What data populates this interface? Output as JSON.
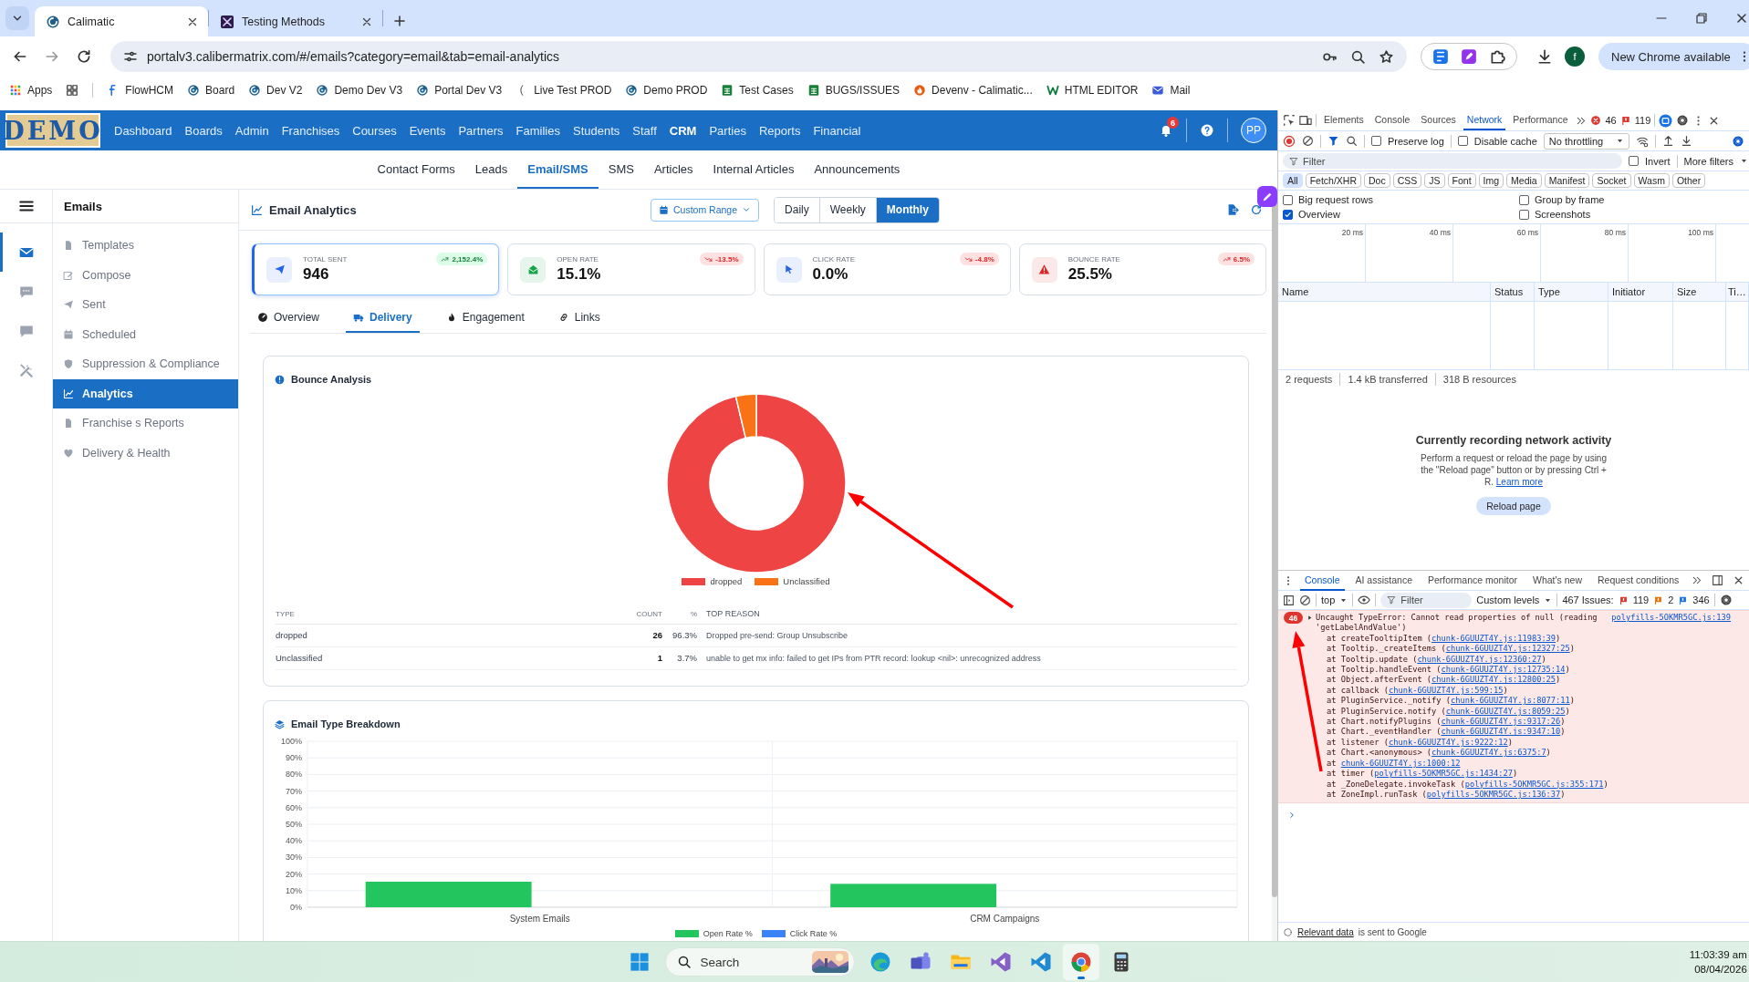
{
  "browser": {
    "tabs": [
      {
        "title": "Calimatic",
        "selected": true
      },
      {
        "title": "Testing Methods",
        "selected": false
      }
    ],
    "url": "portalv3.calibermatrix.com/#/emails?category=email&tab=email-analytics",
    "profile_initial": "f",
    "update_button": "New Chrome available",
    "bookmarks": [
      "Apps",
      "FlowHCM",
      "Board",
      "Dev V2",
      "Demo Dev V3",
      "Portal Dev V3",
      "Live Test PROD",
      "Demo PROD",
      "Test Cases",
      "BUGS/ISSUES",
      "Devenv - Calimatic...",
      "HTML EDITOR",
      "Mail"
    ]
  },
  "app": {
    "logo_text": "DEMO",
    "nav": [
      {
        "label": "Dashboard",
        "selected": false
      },
      {
        "label": "Boards",
        "selected": false
      },
      {
        "label": "Admin",
        "selected": false
      },
      {
        "label": "Franchises",
        "selected": false
      },
      {
        "label": "Courses",
        "selected": false
      },
      {
        "label": "Events",
        "selected": false
      },
      {
        "label": "Partners",
        "selected": false
      },
      {
        "label": "Families",
        "selected": false
      },
      {
        "label": "Students",
        "selected": false
      },
      {
        "label": "Staff",
        "selected": false
      },
      {
        "label": "CRM",
        "selected": true
      },
      {
        "label": "Parties",
        "selected": false
      },
      {
        "label": "Reports",
        "selected": false
      },
      {
        "label": "Financial",
        "selected": false
      }
    ],
    "notification_count": "6",
    "avatar": "PP",
    "subnav": [
      {
        "label": "Contact Forms",
        "selected": false
      },
      {
        "label": "Leads",
        "selected": false
      },
      {
        "label": "Email/SMS",
        "selected": true
      },
      {
        "label": "SMS",
        "selected": false
      },
      {
        "label": "Articles",
        "selected": false
      },
      {
        "label": "Internal Articles",
        "selected": false
      },
      {
        "label": "Announcements",
        "selected": false
      }
    ],
    "rail": [
      {
        "selected": true
      },
      {
        "selected": false
      },
      {
        "selected": false
      },
      {
        "selected": false
      }
    ],
    "sidebar": {
      "title": "Emails",
      "items": [
        {
          "label": "Templates",
          "selected": false
        },
        {
          "label": "Compose",
          "selected": false
        },
        {
          "label": "Sent",
          "selected": false
        },
        {
          "label": "Scheduled",
          "selected": false
        },
        {
          "label": "Suppression & Compliance",
          "selected": false
        },
        {
          "label": "Analytics",
          "selected": true
        },
        {
          "label": "Franchise s Reports",
          "selected": false
        },
        {
          "label": "Delivery & Health",
          "selected": false
        }
      ]
    },
    "header": {
      "title": "Email Analytics",
      "range_button": "Custom Range",
      "periods": [
        {
          "label": "Daily",
          "selected": false
        },
        {
          "label": "Weekly",
          "selected": false
        },
        {
          "label": "Monthly",
          "selected": true
        }
      ]
    },
    "kpis": [
      {
        "label": "TOTAL SENT",
        "value": "946",
        "change": "2,152.4%",
        "trend_up": true,
        "favorable": true,
        "color": "#2563eb",
        "selected": true
      },
      {
        "label": "OPEN RATE",
        "value": "15.1%",
        "change": "-13.5%",
        "trend_up": false,
        "favorable": false,
        "color": "#16a34a",
        "selected": false
      },
      {
        "label": "CLICK RATE",
        "value": "0.0%",
        "change": "-4.8%",
        "trend_up": false,
        "favorable": false,
        "color": "#2563eb",
        "selected": false
      },
      {
        "label": "BOUNCE RATE",
        "value": "25.5%",
        "change": "6.5%",
        "trend_up": true,
        "favorable": false,
        "color": "#dc2626",
        "selected": false
      }
    ],
    "tabs": [
      {
        "label": "Overview",
        "selected": false
      },
      {
        "label": "Delivery",
        "selected": true
      },
      {
        "label": "Engagement",
        "selected": false
      },
      {
        "label": "Links",
        "selected": false
      }
    ],
    "bounce": {
      "title": "Bounce Analysis",
      "chart_data": {
        "type": "donut",
        "legend": "bottom",
        "categories": [
          "dropped",
          "Unclassified"
        ],
        "values": [
          96.3,
          3.7
        ]
      },
      "columns": [
        "TYPE",
        "COUNT",
        "%",
        "TOP REASON"
      ],
      "rows": [
        {
          "type": "dropped",
          "count": "26",
          "percent": "96.3%",
          "reason": "Dropped pre-send: Group Unsubscribe"
        },
        {
          "type": "Unclassified",
          "count": "1",
          "percent": "3.7%",
          "reason": "unable to get mx info: failed to get IPs from PTR record: lookup <nil>: unrecognized address"
        }
      ]
    },
    "breakdown": {
      "title": "Email Type Breakdown",
      "chart_data": {
        "type": "bar",
        "categories": [
          "System Emails",
          "CRM Campaigns"
        ],
        "series": [
          {
            "name": "Open Rate %",
            "color": "#22c55e",
            "values": [
              15.4,
              14.1
            ]
          },
          {
            "name": "Click Rate %",
            "color": "#3b82f6",
            "values": [
              0,
              0
            ]
          }
        ],
        "grid": true,
        "legend": "bottom",
        "ylim": [
          0,
          100
        ],
        "yticks": [
          {
            "value": 0,
            "label": "0%"
          },
          {
            "value": 10,
            "label": "10%"
          },
          {
            "value": 20,
            "label": "20%"
          },
          {
            "value": 30,
            "label": "30%"
          },
          {
            "value": 40,
            "label": "40%"
          },
          {
            "value": 50,
            "label": "50%"
          },
          {
            "value": 60,
            "label": "60%"
          },
          {
            "value": 70,
            "label": "70%"
          },
          {
            "value": 80,
            "label": "80%"
          },
          {
            "value": 90,
            "label": "90%"
          },
          {
            "value": 100,
            "label": "100%"
          }
        ]
      }
    }
  },
  "devtools": {
    "tabs": [
      {
        "label": "Elements",
        "selected": false
      },
      {
        "label": "Console",
        "selected": false
      },
      {
        "label": "Sources",
        "selected": false
      },
      {
        "label": "Network",
        "selected": true
      },
      {
        "label": "Performance",
        "selected": false
      }
    ],
    "error_count": "46",
    "warning_count": "119",
    "preserve_log": {
      "label": "Preserve log",
      "checked": false
    },
    "disable_cache": {
      "label": "Disable cache",
      "checked": false
    },
    "throttling": "No throttling",
    "filter_placeholder": "Filter",
    "invert": {
      "label": "Invert",
      "checked": false
    },
    "more_filters": "More filters",
    "type_filters": [
      {
        "label": "All",
        "selected": true
      },
      {
        "label": "Fetch/XHR",
        "selected": false
      },
      {
        "label": "Doc",
        "selected": false
      },
      {
        "label": "CSS",
        "selected": false
      },
      {
        "label": "JS",
        "selected": false
      },
      {
        "label": "Font",
        "selected": false
      },
      {
        "label": "Img",
        "selected": false
      },
      {
        "label": "Media",
        "selected": false
      },
      {
        "label": "Manifest",
        "selected": false
      },
      {
        "label": "Socket",
        "selected": false
      },
      {
        "label": "Wasm",
        "selected": false
      },
      {
        "label": "Other",
        "selected": false
      }
    ],
    "options": [
      {
        "label": "Big request rows",
        "checked": false
      },
      {
        "label": "Group by frame",
        "checked": false
      },
      {
        "label": "Overview",
        "checked": true
      },
      {
        "label": "Screenshots",
        "checked": false
      }
    ],
    "timeline_ticks": [
      "20 ms",
      "40 ms",
      "60 ms",
      "80 ms",
      "100 ms"
    ],
    "columns": [
      "Name",
      "Status",
      "Type",
      "Initiator",
      "Size",
      "Ti…"
    ],
    "summary": [
      "2 requests",
      "1.4 kB transferred",
      "318 B resources"
    ],
    "empty_title": "Currently recording network activity",
    "empty_text": "Perform a request or reload the page by using the \"Reload page\" button or by pressing Ctrl + R.",
    "learn_more": "Learn more",
    "reload_button": "Reload page",
    "drawer_tabs": [
      {
        "label": "Console",
        "selected": true
      },
      {
        "label": "AI assistance",
        "selected": false
      },
      {
        "label": "Performance monitor",
        "selected": false
      },
      {
        "label": "What's new",
        "selected": false
      },
      {
        "label": "Request conditions",
        "selected": false
      }
    ],
    "context": "top",
    "console_filter_placeholder": "Filter",
    "levels": "Custom levels",
    "issues_label": "467 Issues:",
    "issue_counts": [
      "119",
      "2",
      "346"
    ],
    "error": {
      "count": "46",
      "message": "Uncaught TypeError: Cannot read properties of null (reading 'getLabelAndValue')",
      "source": "polyfills-5OKMR5GC.js:139",
      "stack": [
        {
          "before": "at createTooltipItem (",
          "link": "chunk-6GUUZT4Y.js:11983:39",
          "after": ")"
        },
        {
          "before": "at Tooltip._createItems (",
          "link": "chunk-6GUUZT4Y.js:12327:25",
          "after": ")"
        },
        {
          "before": "at Tooltip.update (",
          "link": "chunk-6GUUZT4Y.js:12360:27",
          "after": ")"
        },
        {
          "before": "at Tooltip.handleEvent (",
          "link": "chunk-6GUUZT4Y.js:12735:14",
          "after": ")"
        },
        {
          "before": "at Object.afterEvent (",
          "link": "chunk-6GUUZT4Y.js:12800:25",
          "after": ")"
        },
        {
          "before": "at callback (",
          "link": "chunk-6GUUZT4Y.js:599:15",
          "after": ")"
        },
        {
          "before": "at PluginService._notify (",
          "link": "chunk-6GUUZT4Y.js:8077:11",
          "after": ")"
        },
        {
          "before": "at PluginService.notify (",
          "link": "chunk-6GUUZT4Y.js:8059:25",
          "after": ")"
        },
        {
          "before": "at Chart.notifyPlugins (",
          "link": "chunk-6GUUZT4Y.js:9317:26",
          "after": ")"
        },
        {
          "before": "at Chart._eventHandler (",
          "link": "chunk-6GUUZT4Y.js:9347:10",
          "after": ")"
        },
        {
          "before": "at listener (",
          "link": "chunk-6GUUZT4Y.js:9222:12",
          "after": ")"
        },
        {
          "before": "at Chart.<anonymous> (",
          "link": "chunk-6GUUZT4Y.js:6375:7",
          "after": ")"
        },
        {
          "before": "at ",
          "link": "chunk-6GUUZT4Y.js:1000:12"
        },
        {
          "before": "at timer (",
          "link": "polyfills-5OKMR5GC.js:1434:27",
          "after": ")"
        },
        {
          "before": "at _ZoneDelegate.invokeTask (",
          "link": "polyfills-5OKMR5GC.js:355:171",
          "after": ")"
        },
        {
          "before": "at ZoneImpl.runTask (",
          "link": "polyfills-5OKMR5GC.js:136:37",
          "after": ")"
        }
      ]
    },
    "footer_link": "Relevant data",
    "footer_text": "is sent to Google"
  },
  "taskbar": {
    "search": "Search",
    "apps": [
      {
        "selected": false
      },
      {
        "selected": false
      },
      {
        "selected": false
      },
      {
        "selected": false
      },
      {
        "selected": false
      },
      {
        "selected": true
      },
      {
        "selected": false
      }
    ],
    "time": "11:03:39 am",
    "date": "08/04/2026"
  }
}
